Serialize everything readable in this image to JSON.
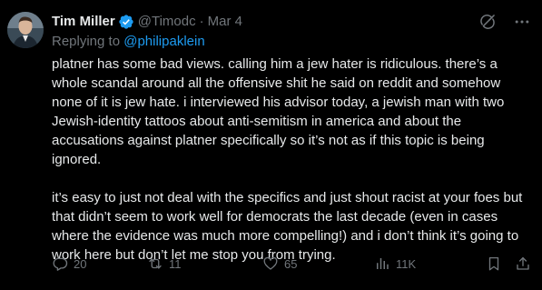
{
  "author": {
    "display_name": "Tim Miller",
    "handle": "@Timodc",
    "separator": "·",
    "date": "Mar 4"
  },
  "reply": {
    "prefix": "Replying to ",
    "to": "@philipaklein"
  },
  "tweet": {
    "paragraph_1": "platner has some bad views. calling him a jew hater is ridiculous. there’s a whole scandal around all the offensive shit he said on reddit and somehow none of it is jew hate. i interviewed his advisor today, a jewish man with two Jewish-identity tattoos about anti-semitism in america and about the accusations against platner specifically so it’s not as if this topic is being ignored.",
    "paragraph_2": "it’s easy to just not deal with the specifics and just shout racist at your foes but that didn’t seem to work well for democrats the last decade (even in cases where the evidence was much more compelling!) and i don’t think it’s going to work here but don’t let me stop you from trying."
  },
  "actions": {
    "replies": "20",
    "reposts": "11",
    "likes": "65",
    "views": "11K"
  },
  "colors": {
    "background": "#000000",
    "text": "#e7e9ea",
    "muted": "#71767b",
    "link": "#1d9bf0",
    "verified": "#1d9bf0"
  },
  "icons": {
    "verified": "verified-badge-icon",
    "grok": "grok-icon",
    "more": "more-icon",
    "reply": "reply-icon",
    "repost": "repost-icon",
    "like": "like-icon",
    "views": "views-icon",
    "bookmark": "bookmark-icon",
    "share": "share-icon"
  }
}
